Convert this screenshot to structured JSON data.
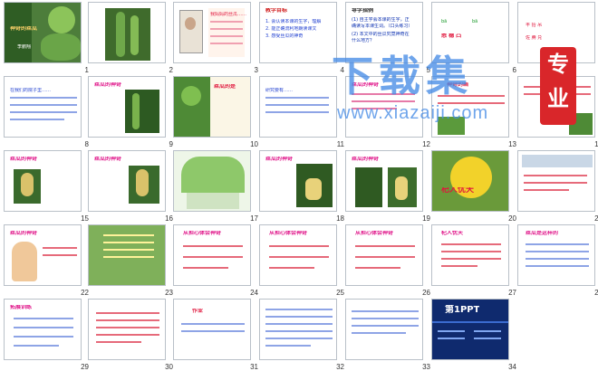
{
  "slides": [
    {
      "n": "1",
      "lines": [
        "神奇的丝瓜",
        "李鹏翔"
      ]
    },
    {
      "n": "2",
      "lines": []
    },
    {
      "n": "3",
      "lines": [
        "我妈妈的丝瓜……"
      ]
    },
    {
      "n": "4",
      "lines": [
        "教学目标",
        "1. 会认读本课的生字，理解",
        "2. 能正确流利地朗读课文",
        "3. 感受丝瓜的神奇"
      ]
    },
    {
      "n": "5",
      "lines": [
        "导学指例",
        "(1) 自主学会本课的生字，正",
        "确读写本课生词。（口头练习）",
        "(2) 本文中的丝瓜究竟神奇在",
        "什么地方？"
      ]
    },
    {
      "n": "6",
      "lines": [
        "bā",
        "bā",
        "悉 穗 凸"
      ]
    },
    {
      "n": "7",
      "lines": [
        "丰 抬 吊",
        "佐 腾 兑"
      ]
    },
    {
      "n": "8",
      "lines": [
        "在我们的院子里……"
      ]
    },
    {
      "n": "9",
      "lines": [
        "丝瓜的神奇"
      ]
    },
    {
      "n": "10",
      "lines": [
        "丝瓜的是"
      ]
    },
    {
      "n": "11",
      "lines": [
        "研究要有……"
      ]
    },
    {
      "n": "12",
      "lines": [
        "丝瓜的神奇"
      ]
    },
    {
      "n": "13",
      "lines": [
        "神奇的画"
      ]
    },
    {
      "n": "14",
      "lines": []
    },
    {
      "n": "15",
      "lines": [
        "丝瓜的神奇"
      ]
    },
    {
      "n": "16",
      "lines": [
        "丝瓜的神奇"
      ]
    },
    {
      "n": "17",
      "lines": []
    },
    {
      "n": "18",
      "lines": [
        "丝瓜的神奇"
      ]
    },
    {
      "n": "19",
      "lines": [
        "丝瓜的神奇"
      ]
    },
    {
      "n": "20",
      "lines": [
        "杞人忧天"
      ]
    },
    {
      "n": "21",
      "lines": []
    },
    {
      "n": "22",
      "lines": [
        "丝瓜的神奇"
      ]
    },
    {
      "n": "23",
      "lines": []
    },
    {
      "n": "24",
      "lines": [
        "从担心体会神奇"
      ]
    },
    {
      "n": "25",
      "lines": [
        "从担心体会神奇"
      ]
    },
    {
      "n": "26",
      "lines": [
        "从担心体会神奇"
      ]
    },
    {
      "n": "27",
      "lines": [
        "杞人忧天"
      ]
    },
    {
      "n": "28",
      "lines": [
        "丝瓜是这样的"
      ]
    },
    {
      "n": "29",
      "lines": [
        "拓展训练"
      ]
    },
    {
      "n": "30",
      "lines": []
    },
    {
      "n": "31",
      "lines": [
        "作业"
      ]
    },
    {
      "n": "32",
      "lines": []
    },
    {
      "n": "33",
      "lines": []
    },
    {
      "n": "34",
      "lines": [
        "第1PPT"
      ]
    }
  ],
  "watermark": {
    "main": "下载集",
    "url": "www.xiazaiji.com",
    "badge_top": "专",
    "badge_bottom": "业"
  },
  "colors": {
    "blue_text": "#1f3fd0",
    "red_text": "#e0163c",
    "border": "#b9c0c8"
  }
}
